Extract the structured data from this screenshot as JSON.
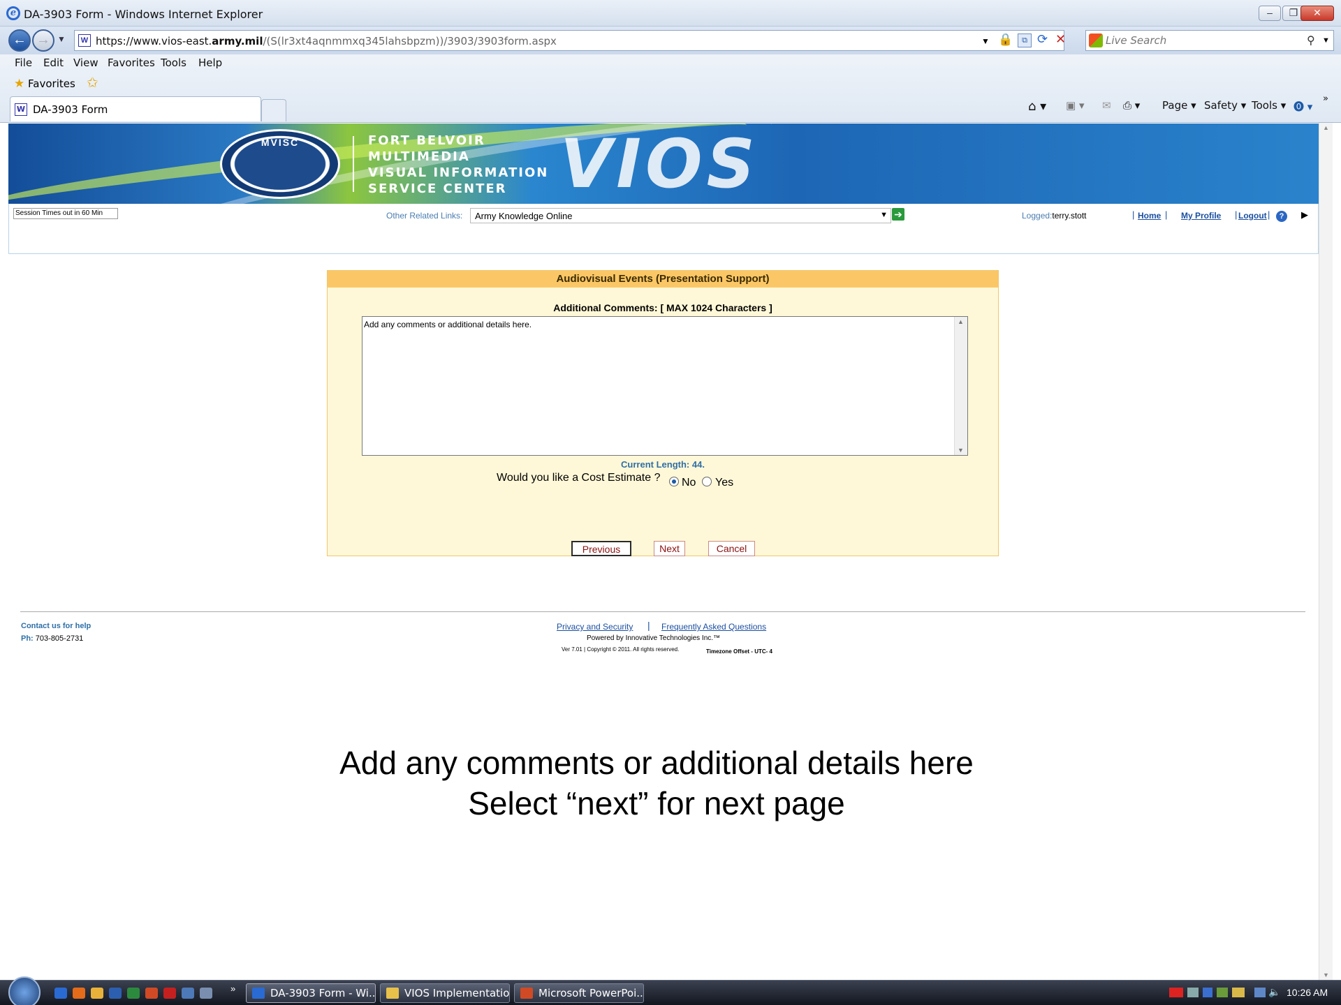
{
  "window": {
    "title": "DA-3903 Form - Windows Internet Explorer"
  },
  "browser": {
    "url_host": "https://www.vios-east.",
    "url_domain": "army.mil",
    "url_path": "/(S(lr3xt4aqnmmxq345lahsbpzm))/3903/3903form.aspx",
    "search_placeholder": "Live Search",
    "menu": [
      "File",
      "Edit",
      "View",
      "Favorites",
      "Tools",
      "Help"
    ],
    "favorites_label": "Favorites",
    "tab_label": "DA-3903 Form",
    "commands": {
      "page": "Page",
      "safety": "Safety",
      "tools": "Tools"
    }
  },
  "banner": {
    "seal_text": "MVISC",
    "lines": [
      "FORT BELVOIR",
      "MULTIMEDIA",
      "VISUAL INFORMATION",
      "SERVICE CENTER"
    ],
    "logo": "VIOS"
  },
  "nav": {
    "session": "Session Times out in 60 Min",
    "related_label": "Other Related Links:",
    "related_selected": "Army Knowledge Online",
    "logged_label": "Logged:",
    "logged_user": "terry.stott",
    "home": "Home",
    "profile": "My Profile",
    "logout": "Logout"
  },
  "form": {
    "header": "Audiovisual Events (Presentation Support)",
    "comments_label": "Additional Comments: [ MAX 1024 Characters ]",
    "comments_value": "Add any comments or additional details here.",
    "current_length": "Current Length: 44.",
    "cost_question": "Would you like a Cost Estimate ?",
    "cost_options": [
      "No",
      "Yes"
    ],
    "cost_selected": "No",
    "buttons": {
      "previous": "Previous",
      "next": "Next",
      "cancel": "Cancel"
    }
  },
  "footer": {
    "contact": "Contact us for help",
    "phone_label": "Ph:",
    "phone": "703-805-2731",
    "privacy": "Privacy and Security",
    "faq": "Frequently Asked Questions",
    "powered": "Powered by Innovative Technologies Inc.™",
    "version": "Ver 7.01 | Copyright © 2011. All rights reserved.",
    "timezone": "Timezone Offset - UTC- 4"
  },
  "caption": {
    "line1": "Add any comments or additional details here",
    "line2": "Select “next” for next page"
  },
  "taskbar": {
    "buttons": [
      "DA-3903 Form - Wi...",
      "VIOS Implementation",
      "Microsoft PowerPoi..."
    ],
    "clock": "10:26 AM"
  },
  "colors": {
    "form_header": "#fbc766",
    "form_bg": "#fff8d8",
    "link": "#1b4fa0",
    "length_text": "#2f6fa6",
    "button_text": "#8a1010"
  }
}
